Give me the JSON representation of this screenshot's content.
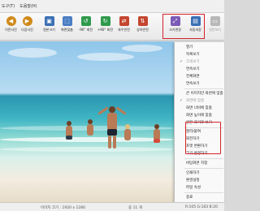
{
  "menubar": {
    "items": [
      "도구(T)",
      "도움말(H)"
    ]
  },
  "toolbar": {
    "items": [
      {
        "label": "이전사진",
        "icon": "previous-icon"
      },
      {
        "label": "다음사진",
        "icon": "next-icon"
      },
      {
        "label": "원본크기",
        "icon": "original-size-icon"
      },
      {
        "label": "화면맞춤",
        "icon": "fit-screen-icon"
      },
      {
        "label": "-90° 회전",
        "icon": "rotate-left-icon"
      },
      {
        "label": "+90° 회전",
        "icon": "rotate-right-icon"
      },
      {
        "label": "좌우반전",
        "icon": "flip-horizontal-icon"
      },
      {
        "label": "상하반전",
        "icon": "flip-vertical-icon"
      },
      {
        "label": "크기변경",
        "icon": "resize-icon"
      },
      {
        "label": "자동저장",
        "icon": "auto-save-icon"
      },
      {
        "label": "일반보기",
        "icon": "normal-view-icon"
      }
    ]
  },
  "context_menu": {
    "items": [
      {
        "label": "열기",
        "check": false,
        "disabled": false
      },
      {
        "label": "목록보기",
        "check": false,
        "disabled": false
      },
      {
        "label": "크게보기",
        "check": true,
        "disabled": true
      },
      {
        "label": "연속보기",
        "check": false,
        "disabled": false
      },
      {
        "label": "전체화면",
        "check": false,
        "disabled": false
      },
      {
        "label": "연속보기",
        "check": false,
        "disabled": false
      },
      {
        "label": "큰 이미지만 화면에 맞춤",
        "check": false,
        "disabled": false
      },
      {
        "label": "화면에 맞춤",
        "check": true,
        "disabled": true
      },
      {
        "label": "화면 너비에 맞춤",
        "check": false,
        "disabled": false
      },
      {
        "label": "화면 높이에 맞춤",
        "check": false,
        "disabled": false
      },
      {
        "label": "원본 크기로 보기",
        "check": false,
        "disabled": false
      },
      {
        "label": "잘라/붙여",
        "check": false,
        "disabled": false
      },
      {
        "label": "회전하기",
        "check": false,
        "disabled": false
      },
      {
        "label": "포맷 변환하기",
        "check": false,
        "disabled": false
      },
      {
        "label": "크기 변경하기",
        "check": false,
        "disabled": false
      },
      {
        "label": "바탕화면 지정",
        "check": false,
        "disabled": false
      },
      {
        "label": "인쇄하기",
        "check": false,
        "disabled": false
      },
      {
        "label": "환경설정",
        "check": false,
        "disabled": false
      },
      {
        "label": "파일 속성",
        "check": false,
        "disabled": false
      },
      {
        "label": "종료",
        "check": false,
        "disabled": false
      }
    ]
  },
  "status": {
    "image_size": "이미지 크기 : 1920 x 1280",
    "file_size": "용 11 개",
    "color": "R:105 G:183 B:20"
  },
  "colors": {
    "highlight_border": "#d6222a",
    "accent": "#d08a1a"
  }
}
